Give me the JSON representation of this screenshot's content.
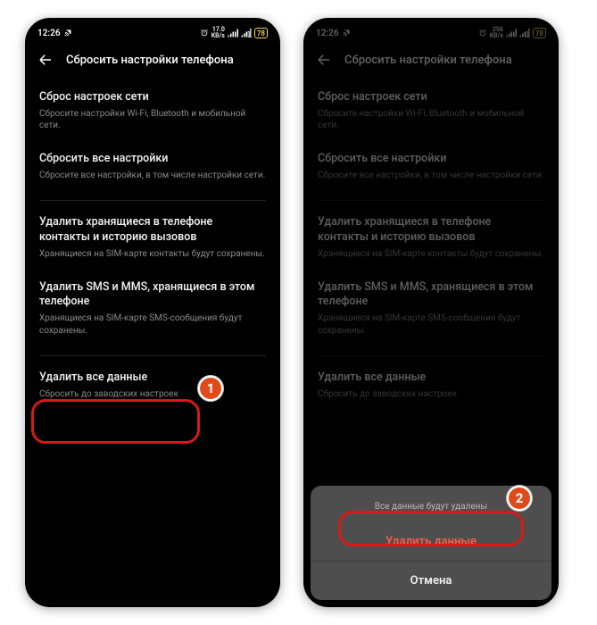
{
  "statusbar": {
    "time": "12:26",
    "net1": "17.0",
    "net2": "256",
    "unit": "KB/s",
    "battery": "78"
  },
  "header": {
    "title": "Сбросить настройки телефона"
  },
  "items": {
    "netreset": {
      "title": "Сброс настроек сети",
      "sub": "Сбросите настройки Wi-Fi, Bluetooth и мобильной сети."
    },
    "allreset": {
      "title": "Сбросить все настройки",
      "sub": "Сбросите все настройки, в том числе настройки сети."
    },
    "contacts": {
      "title": "Удалить хранящиеся в телефоне контакты и историю вызовов",
      "sub": "Хранящиеся на SIM-карте контакты будут сохранены."
    },
    "sms": {
      "title": "Удалить SMS и MMS, хранящиеся в этом телефоне",
      "sub": "Хранящиеся на SIM-карте SMS-сообщения будут сохранены."
    },
    "wipe": {
      "title": "Удалить все данные",
      "sub": "Сбросить до заводских настроек"
    }
  },
  "sheet": {
    "msg": "Все данные будут удалены",
    "confirm": "Удалить данные",
    "cancel": "Отмена"
  },
  "badges": {
    "one": "1",
    "two": "2"
  }
}
